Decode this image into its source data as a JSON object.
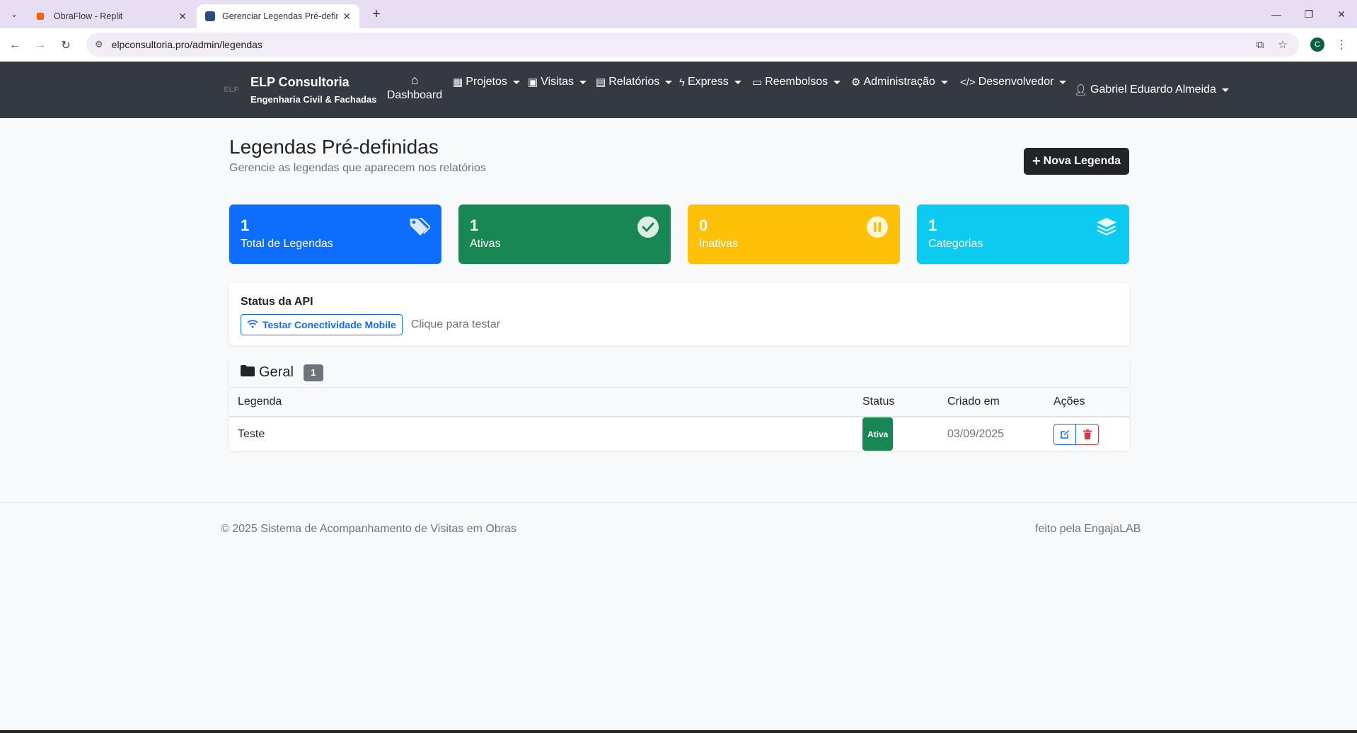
{
  "browser": {
    "tabs": [
      {
        "title": "ObraFlow - Replit",
        "active": false
      },
      {
        "title": "Gerenciar Legendas Pré-definid",
        "active": true
      }
    ],
    "url": "elpconsultoria.pro/admin/legendas",
    "profile_initial": "C"
  },
  "navbar": {
    "brand_logo": "ELP",
    "brand_name": "ELP Consultoria",
    "brand_sub": "Engenharia Civil & Fachadas",
    "dashboard": "Dashboard",
    "items": [
      "Projetos",
      "Visitas",
      "Relatórios",
      "Express",
      "Reembolsos",
      "Administração",
      "Desenvolvedor"
    ],
    "user": "Gabriel Eduardo Almeida"
  },
  "header": {
    "title": "Legendas Pré-definidas",
    "subtitle": "Gerencie as legendas que aparecem nos relatórios",
    "new_button": "Nova Legenda"
  },
  "stats": [
    {
      "value": "1",
      "label": "Total de Legendas",
      "color": "#0d6efd",
      "icon": "tags-icon"
    },
    {
      "value": "1",
      "label": "Ativas",
      "color": "#198754",
      "icon": "check-circle-icon"
    },
    {
      "value": "0",
      "label": "Inativas",
      "color": "#ffc107",
      "icon": "pause-circle-icon"
    },
    {
      "value": "1",
      "label": "Categorias",
      "color": "#0dcaf0",
      "icon": "layers-icon"
    }
  ],
  "api": {
    "title": "Status da API",
    "button": "Testar Conectividade Mobile",
    "hint": "Clique para testar"
  },
  "category": {
    "name": "Geral",
    "count": "1",
    "columns": [
      "Legenda",
      "Status",
      "Criado em",
      "Ações"
    ],
    "rows": [
      {
        "legenda": "Teste",
        "status": "Ativa",
        "criado_em": "03/09/2025"
      }
    ]
  },
  "footer": {
    "left": "© 2025 Sistema de Acompanhamento de Visitas em Obras",
    "right": "feito pela EngajaLAB"
  }
}
